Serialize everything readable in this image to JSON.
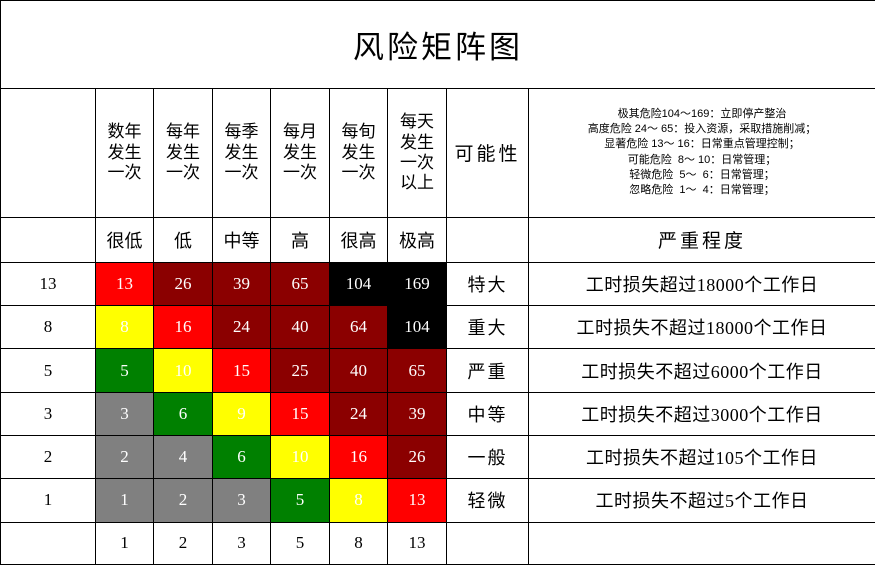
{
  "title": "风险矩阵图",
  "header": {
    "possibility_label": "可能性",
    "severity_label": "严重程度",
    "frequencies": [
      "数年\n发生\n一次",
      "每年\n发生\n一次",
      "每季\n发生\n一次",
      "每月\n发生\n一次",
      "每旬\n发生\n一次",
      "每天\n发生\n一次\n以上"
    ],
    "levels": [
      "很低",
      "低",
      "中等",
      "高",
      "很高",
      "极高"
    ]
  },
  "legend": {
    "lines": [
      "极其危险104～169：立即停产整治",
      "高度危险 24～ 65：投入资源，采取措施削减；",
      "显著危险 13～ 16：日常重点管理控制；",
      "可能危险  8～ 10：日常管理；",
      "轻微危险  5～  6：日常管理；",
      "忽略危险  1～  4：日常管理；"
    ]
  },
  "colors": {
    "black": "#000000",
    "dark_red": "#8B0000",
    "red": "#FF0000",
    "yellow": "#FFFF00",
    "green": "#008000",
    "gray": "#808080",
    "white": "#FFFFFF"
  },
  "footer": {
    "probability_scale": [
      "1",
      "2",
      "3",
      "5",
      "8",
      "13"
    ]
  },
  "chart_data": {
    "type": "heatmap",
    "title": "风险矩阵图",
    "xlabel": "可能性",
    "ylabel": "严重程度",
    "x_categories": [
      "很低",
      "低",
      "中等",
      "高",
      "很高",
      "极高"
    ],
    "x_tick_labels": [
      "1",
      "2",
      "3",
      "5",
      "8",
      "13"
    ],
    "x_descriptions": [
      "数年发生一次",
      "每年发生一次",
      "每季发生一次",
      "每月发生一次",
      "每旬发生一次",
      "每天发生一次以上"
    ],
    "y_categories": [
      "特大",
      "重大",
      "严重",
      "中等",
      "一般",
      "轻微"
    ],
    "y_tick_labels": [
      "13",
      "8",
      "5",
      "3",
      "2",
      "1"
    ],
    "y_descriptions": [
      "工时损失超过18000个工作日",
      "工时损失不超过18000个工作日",
      "工时损失不超过6000个工作日",
      "工时损失不超过3000个工作日",
      "工时损失不超过105个工作日",
      "工时损失不超过5个工作日"
    ],
    "rows": [
      {
        "score": "13",
        "category": "特大",
        "description": "工时损失超过18000个工作日",
        "cells": [
          {
            "value": "13",
            "color": "#FF0000"
          },
          {
            "value": "26",
            "color": "#8B0000"
          },
          {
            "value": "39",
            "color": "#8B0000"
          },
          {
            "value": "65",
            "color": "#8B0000"
          },
          {
            "value": "104",
            "color": "#000000"
          },
          {
            "value": "169",
            "color": "#000000"
          }
        ]
      },
      {
        "score": "8",
        "category": "重大",
        "description": "工时损失不超过18000个工作日",
        "cells": [
          {
            "value": "8",
            "color": "#FFFF00"
          },
          {
            "value": "16",
            "color": "#FF0000"
          },
          {
            "value": "24",
            "color": "#8B0000"
          },
          {
            "value": "40",
            "color": "#8B0000"
          },
          {
            "value": "64",
            "color": "#8B0000"
          },
          {
            "value": "104",
            "color": "#000000"
          }
        ]
      },
      {
        "score": "5",
        "category": "严重",
        "description": "工时损失不超过6000个工作日",
        "cells": [
          {
            "value": "5",
            "color": "#008000"
          },
          {
            "value": "10",
            "color": "#FFFF00"
          },
          {
            "value": "15",
            "color": "#FF0000"
          },
          {
            "value": "25",
            "color": "#8B0000"
          },
          {
            "value": "40",
            "color": "#8B0000"
          },
          {
            "value": "65",
            "color": "#8B0000"
          }
        ]
      },
      {
        "score": "3",
        "category": "中等",
        "description": "工时损失不超过3000个工作日",
        "cells": [
          {
            "value": "3",
            "color": "#808080"
          },
          {
            "value": "6",
            "color": "#008000"
          },
          {
            "value": "9",
            "color": "#FFFF00"
          },
          {
            "value": "15",
            "color": "#FF0000"
          },
          {
            "value": "24",
            "color": "#8B0000"
          },
          {
            "value": "39",
            "color": "#8B0000"
          }
        ]
      },
      {
        "score": "2",
        "category": "一般",
        "description": "工时损失不超过105个工作日",
        "cells": [
          {
            "value": "2",
            "color": "#808080"
          },
          {
            "value": "4",
            "color": "#808080"
          },
          {
            "value": "6",
            "color": "#008000"
          },
          {
            "value": "10",
            "color": "#FFFF00"
          },
          {
            "value": "16",
            "color": "#FF0000"
          },
          {
            "value": "26",
            "color": "#8B0000"
          }
        ]
      },
      {
        "score": "1",
        "category": "轻微",
        "description": "工时损失不超过5个工作日",
        "cells": [
          {
            "value": "1",
            "color": "#808080"
          },
          {
            "value": "2",
            "color": "#808080"
          },
          {
            "value": "3",
            "color": "#808080"
          },
          {
            "value": "5",
            "color": "#008000"
          },
          {
            "value": "8",
            "color": "#FFFF00"
          },
          {
            "value": "13",
            "color": "#FF0000"
          }
        ]
      }
    ]
  }
}
